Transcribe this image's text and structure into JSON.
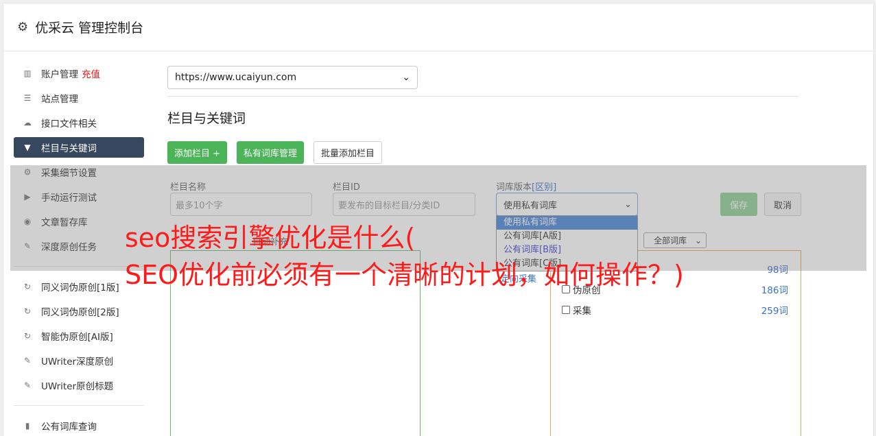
{
  "header": {
    "title": "优采云 管理控制台",
    "icon": "gear-icon"
  },
  "sidebar": {
    "group1": [
      {
        "label": "账户管理",
        "badge": "充值",
        "icon": "bar-chart-icon"
      },
      {
        "label": "站点管理",
        "icon": "server-icon"
      },
      {
        "label": "接口文件相关",
        "icon": "cloud-upload-icon"
      },
      {
        "label": "栏目与关键词",
        "icon": "filter-icon",
        "active": true
      },
      {
        "label": "采集细节设置",
        "icon": "cogs-icon"
      },
      {
        "label": "手动运行测试",
        "icon": "play-icon"
      },
      {
        "label": "文章暂存库",
        "icon": "database-icon"
      },
      {
        "label": "深度原创任务",
        "icon": "edit-icon"
      }
    ],
    "group2": [
      {
        "label": "同义词伪原创[1版]",
        "icon": "refresh-icon"
      },
      {
        "label": "同义词伪原创[2版]",
        "icon": "refresh-icon"
      },
      {
        "label": "智能伪原创[AI版]",
        "icon": "refresh-icon"
      },
      {
        "label": "UWriter深度原创",
        "icon": "edit-icon"
      },
      {
        "label": "UWriter原创标题",
        "icon": "edit-icon"
      }
    ],
    "group3": [
      {
        "label": "公有词库查询",
        "icon": "book-icon"
      }
    ]
  },
  "main": {
    "site_select": "https://www.ucaiyun.com",
    "section_title": "栏目与关键词",
    "buttons": {
      "add_column": "添加栏目 +",
      "private_lib": "私有词库管理",
      "batch_add": "批量添加栏目"
    },
    "form": {
      "name_label": "栏目名称",
      "name_placeholder": "最多10个字",
      "id_label": "栏目ID",
      "id_placeholder": "要发布的目标栏目/分类ID",
      "lib_label": "词库版本",
      "lib_label_link": "[区别]",
      "lib_value": "使用私有词库",
      "save": "保存",
      "cancel": "取消"
    },
    "dropdown_options": [
      "使用私有词库",
      "公有词库[A版]",
      "公有词库[B版]",
      "公有词库[C版]"
    ],
    "keyword_label": "自动补充",
    "lib_filter": "全部词库",
    "link_text": "定向采集",
    "libs": [
      {
        "name": "",
        "count": "98词"
      },
      {
        "name": "伪原创",
        "count": "186词"
      },
      {
        "name": "采集",
        "count": "259词"
      }
    ]
  },
  "watermark": {
    "line1": "seo搜索引擎优化是什么(",
    "line2": "SEO优化前必须有一个清晰的计划，如何操作？)"
  }
}
